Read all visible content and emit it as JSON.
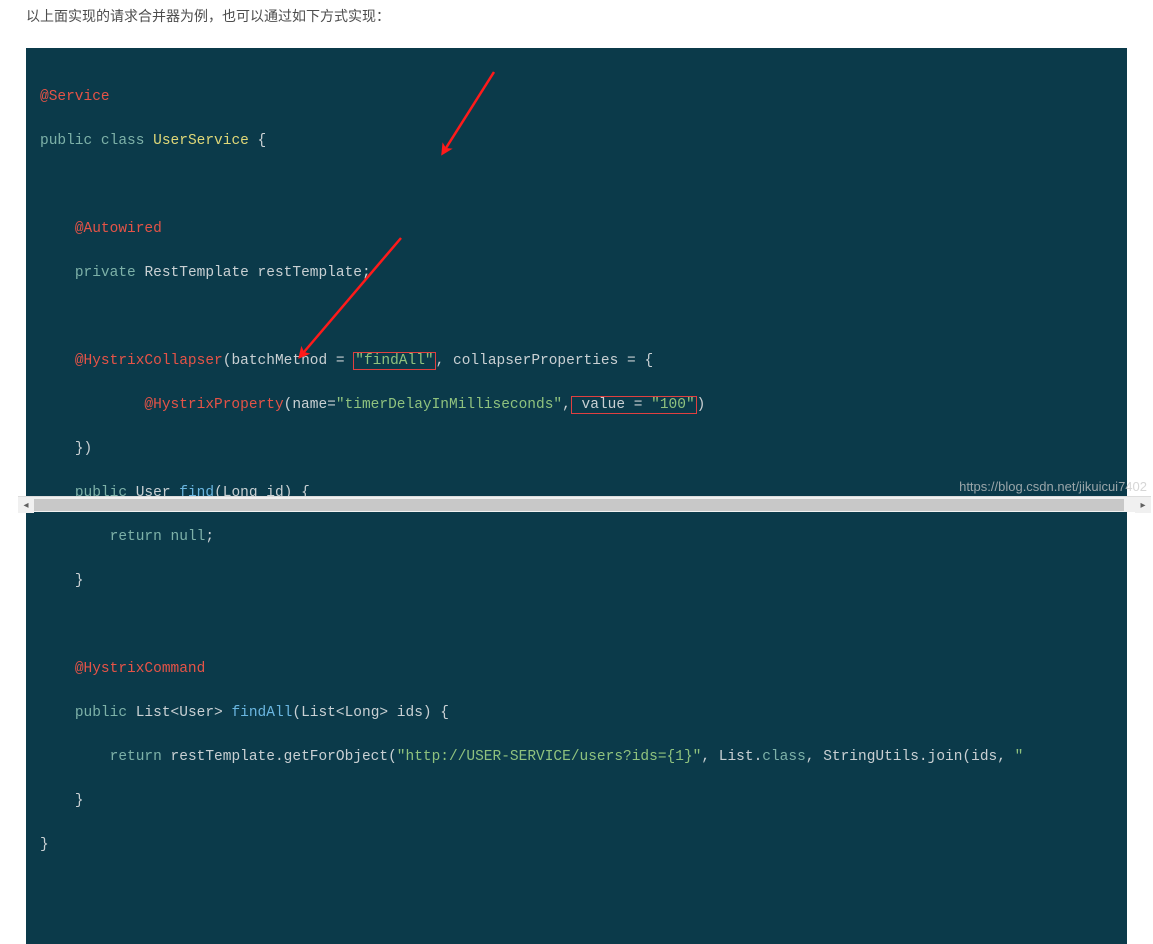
{
  "description": "以上面实现的请求合并器为例，也可以通过如下方式实现：",
  "code": {
    "l1a": "@Service",
    "l2a": "public",
    "l2b": "class",
    "l2c": "UserService",
    "l2d": " {",
    "l3a": "@Autowired",
    "l4a": "private",
    "l4b": "RestTemplate restTemplate",
    "l4c": ";",
    "l5a": "@HystrixCollapser",
    "l5b": "(batchMethod = ",
    "l5c": "\"findAll\"",
    "l5d": ", collapserProperties = {",
    "l6a": "@HystrixProperty",
    "l6b": "(name=",
    "l6c": "\"timerDelayInMilliseconds\"",
    "l6d": ",",
    "l6e": " value = ",
    "l6f": "\"100\"",
    "l6g": ")",
    "l7a": "})",
    "l8a": "public",
    "l8b": "User",
    "l8c": "find",
    "l8d": "(Long id) {",
    "l9a": "return",
    "l9b": "null",
    "l9c": ";",
    "l10a": "}",
    "l11a": "@HystrixCommand",
    "l12a": "public",
    "l12b": "List<User>",
    "l12c": "findAll",
    "l12d": "(List<Long> ids) {",
    "l13a": "return",
    "l13b": " restTemplate.getForObject(",
    "l13c": "\"http://USER-SERVICE/users?ids={1}\"",
    "l13d": ", List.",
    "l13e": "class",
    "l13f": ", StringUtils.join(ids, ",
    "l13g": "\"",
    "l14a": "}",
    "l15a": "}"
  },
  "watermark": "https://blog.csdn.net/jikuicui7402",
  "indent1": "    ",
  "indent2": "        ",
  "indent3": "            "
}
